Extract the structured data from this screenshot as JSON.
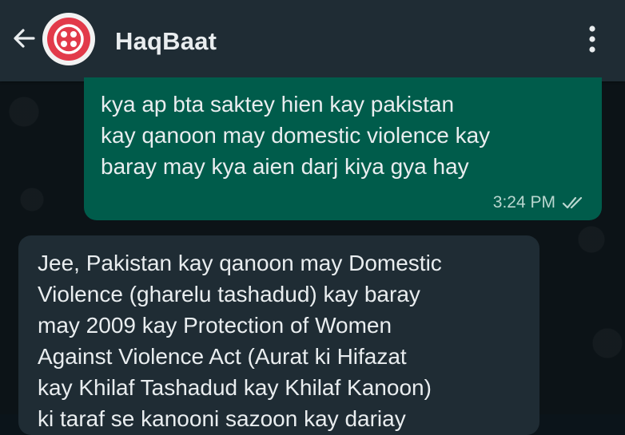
{
  "header": {
    "title": "HaqBaat",
    "icons": {
      "back": "arrow-left-icon",
      "avatar": "twilio-logo",
      "menu": "more-vertical-icon"
    }
  },
  "messages": [
    {
      "direction": "outgoing",
      "text": "kya ap bta saktey hien kay pakistan\nkay qanoon may domestic violence kay\nbaray may kya aien darj kiya gya hay",
      "time": "3:24 PM",
      "status": "delivered-double-tick"
    },
    {
      "direction": "incoming",
      "text": "Jee, Pakistan kay qanoon may Domestic\nViolence (gharelu tashadud) kay baray\nmay 2009 kay Protection of Women\nAgainst Violence Act (Aurat ki Hifazat\nkay Khilaf Tashadud kay Khilaf Kanoon)\nki taraf se kanooni sazoon kay dariay"
    }
  ],
  "colors": {
    "header_bg": "#1f2c34",
    "chat_bg": "#0c1317",
    "outgoing_bubble": "#005c4b",
    "incoming_bubble": "#1f2c34",
    "text": "#e9edef",
    "avatar_red": "#e23a4a"
  }
}
